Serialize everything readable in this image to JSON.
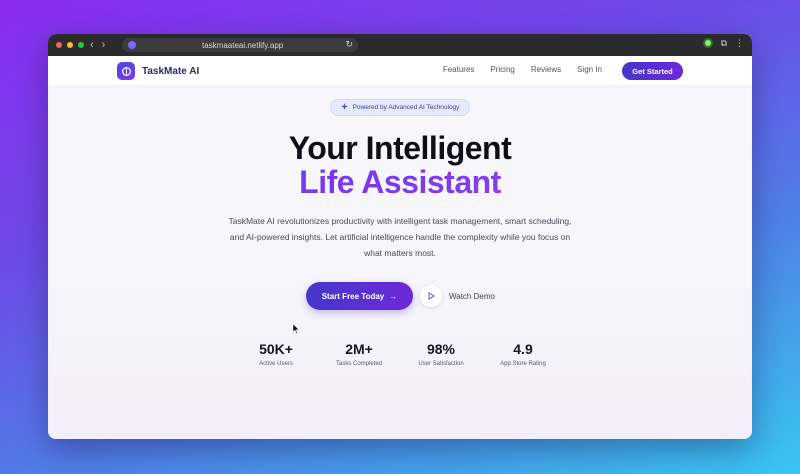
{
  "browser": {
    "url": "taskmaateai.netlify.app",
    "icons": [
      "back-arrow",
      "forward-arrow",
      "reload-icon",
      "extension-green-icon",
      "puzzle-icon",
      "more-icon"
    ]
  },
  "nav": {
    "brand": "TaskMate AI",
    "links": [
      "Features",
      "Pricing",
      "Reviews",
      "Sign In"
    ],
    "cta": "Get Started"
  },
  "hero": {
    "badge": "Powered by Advanced AI Technology",
    "headline_line1": "Your Intelligent",
    "headline_line2": "Life Assistant",
    "description": "TaskMate AI revolutionizes productivity with intelligent task management, smart scheduling, and AI-powered insights. Let artificial intelligence handle the complexity while you focus on what matters most.",
    "primary_button": "Start Free Today",
    "secondary_button": "Watch Demo"
  },
  "stats": [
    {
      "value": "50K+",
      "label": "Active Users"
    },
    {
      "value": "2M+",
      "label": "Tasks Completed"
    },
    {
      "value": "98%",
      "label": "User Satisfaction"
    },
    {
      "value": "4.9",
      "label": "App Store Rating"
    }
  ],
  "colors": {
    "accent_start": "#4338ca",
    "accent_end": "#6d28d9",
    "background_gradient": [
      "#8b2cf0",
      "#38c6ef"
    ]
  }
}
